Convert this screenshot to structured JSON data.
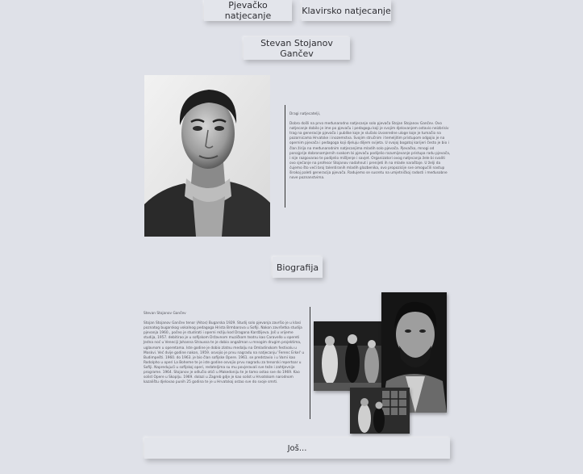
{
  "nav": {
    "tab_vocal": "Pjevačko natjecanje",
    "tab_piano": "Klavirsko natjecanje"
  },
  "profile": {
    "name": "Stevan Stojanov Gančev"
  },
  "letter": {
    "greeting": "Dragi natjecatelji,",
    "body": "Dobro došli na prvo međunarodno natjecanje solo pjevača Stojan Stojanov Gančev. Ovo natjecanje dobilo je ime po pjevaču i pedagogu koji je svojim djelovanjem ostavio neizbrisiv trag na generacije pjevača i publike koje je slušalo izvanredne uloge koje je tumačio na pozornicama Hrvatske i inozemstva. Svojim stručnim i temeljitim pristupom odgojio je na opernim pjevača i pedagoga koji djeluju diljem svijeta. U svojoj bogatoj karijeri često je bio i član žirija na međunarodnim natjecanjima mladih solo pjevača. Pjevačko, mnogi od ponajprije dobronamjernih svakom bi pjevaču podijelio razumijevanje pristupa radu pjevača, i nije razgovarao te podijelio mišljenje i savjet. Organizatori ovog natjecanja žele bi svaliti ovo sjećanje na profesor Stojanov nadahnut i prenijeti ih na mlade naraštaje. U želji da ćujemo što veći broj talentiranih mladih glazbenika, ovo propozicije sve omogućili nastup širokoj paleti generacija pjevača. Radujemo se susretu na umjetničkoj radosti i međusobne nove poznanstvima."
  },
  "bio_section": {
    "button_label": "Biografija",
    "title": "Stevan Stojanov Gančev",
    "body": "Stojan Stojanov Gančev tenor (Aitos) Bugarska 1929. Studij solo pjevanja završio je u klasi poznatog bugarskog vokalnog pedagoga Hrista Brmbarova u Sofiji. Nakon završetka studija pjevanja 1960., počeo je studirati i operni režiju kod Dragana Kardžijeva. Još u vrijeme studija, 1957. debitirao je u sofijskom Državnom muzičkom teatru kao Caravello u opereti Jedna noć u Veneciji Johanna Straussa te je dobio angažman u mnogim drugim projektima, uglavnom u operetama. Iste godine je dobio zlatnu medalju na Omladinskom festivalu u Moskvi. Već dvije godine nakon, 1959. osvojio je prvu nagradu na natjecanju 'Ferenc Erkel' u Budimpešti. 1960. do 1963. je bio član sofijske Opere. 1961. se predstavio i u Varni kao Rodolpho u operi La Boheme te je iste godine osvojio prvu nagradu za tenorski repertoar u Sofiji. Napredujući u sofijskoj operi, redateljima su mu povjeravali sve teže i zahtjevnije programe. 1964. Stojanov je odlučio otići u Makedoniju te je tamo ostao sve do 1969. Kao solist Opere u Skoplju. 1969. dolazi u Zagreb gdje je kao solist u Hrvatskom narodnom kazalištu djelovao punih 25 godina te je u Hrvatskoj ostao sve do svoje smrti."
  },
  "more_button": "Još..."
}
